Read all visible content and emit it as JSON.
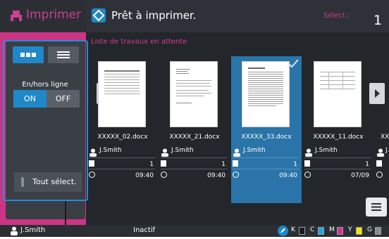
{
  "app": {
    "title": "Imprimer"
  },
  "header": {
    "status": "Prêt à imprimer.",
    "selected_label": "Sélect.:",
    "selected_count": "1"
  },
  "sidebar": {
    "online_label": "En/hors ligne",
    "toggle_on": "ON",
    "toggle_off": "OFF",
    "select_all": "Tout sélect."
  },
  "list": {
    "title": "Liste de travaux en attente",
    "jobs": [
      {
        "file": "XXXXX_02.docx",
        "owner": "J.Smith",
        "pages": "1",
        "time": "09:40",
        "selected": false
      },
      {
        "file": "XXXXX_21.docx",
        "owner": "J.Smith",
        "pages": "1",
        "time": "09:40",
        "selected": false
      },
      {
        "file": "XXXXX_33.docx",
        "owner": "J.Smith",
        "pages": "1",
        "time": "09:40",
        "selected": true
      },
      {
        "file": "XXXXX_11.docx",
        "owner": "J.Smith",
        "pages": "1",
        "time": "07/09",
        "selected": false
      },
      {
        "file": "XX",
        "owner": "J.",
        "pages": "",
        "time": "",
        "selected": false
      }
    ]
  },
  "status_bar": {
    "user": "J.Smith",
    "state": "Inactif",
    "inks": [
      {
        "label": "K",
        "color": "#1a1a1a"
      },
      {
        "label": "C",
        "color": "#1ea7e1"
      },
      {
        "label": "M",
        "color": "#d6338f"
      },
      {
        "label": "Y",
        "color": "#f2e600"
      },
      {
        "label": "G",
        "color": "#8c8c8c"
      }
    ]
  },
  "colors": {
    "accent": "#1e88c9",
    "brand": "#cc3585",
    "selected_card": "#2a74a9"
  }
}
